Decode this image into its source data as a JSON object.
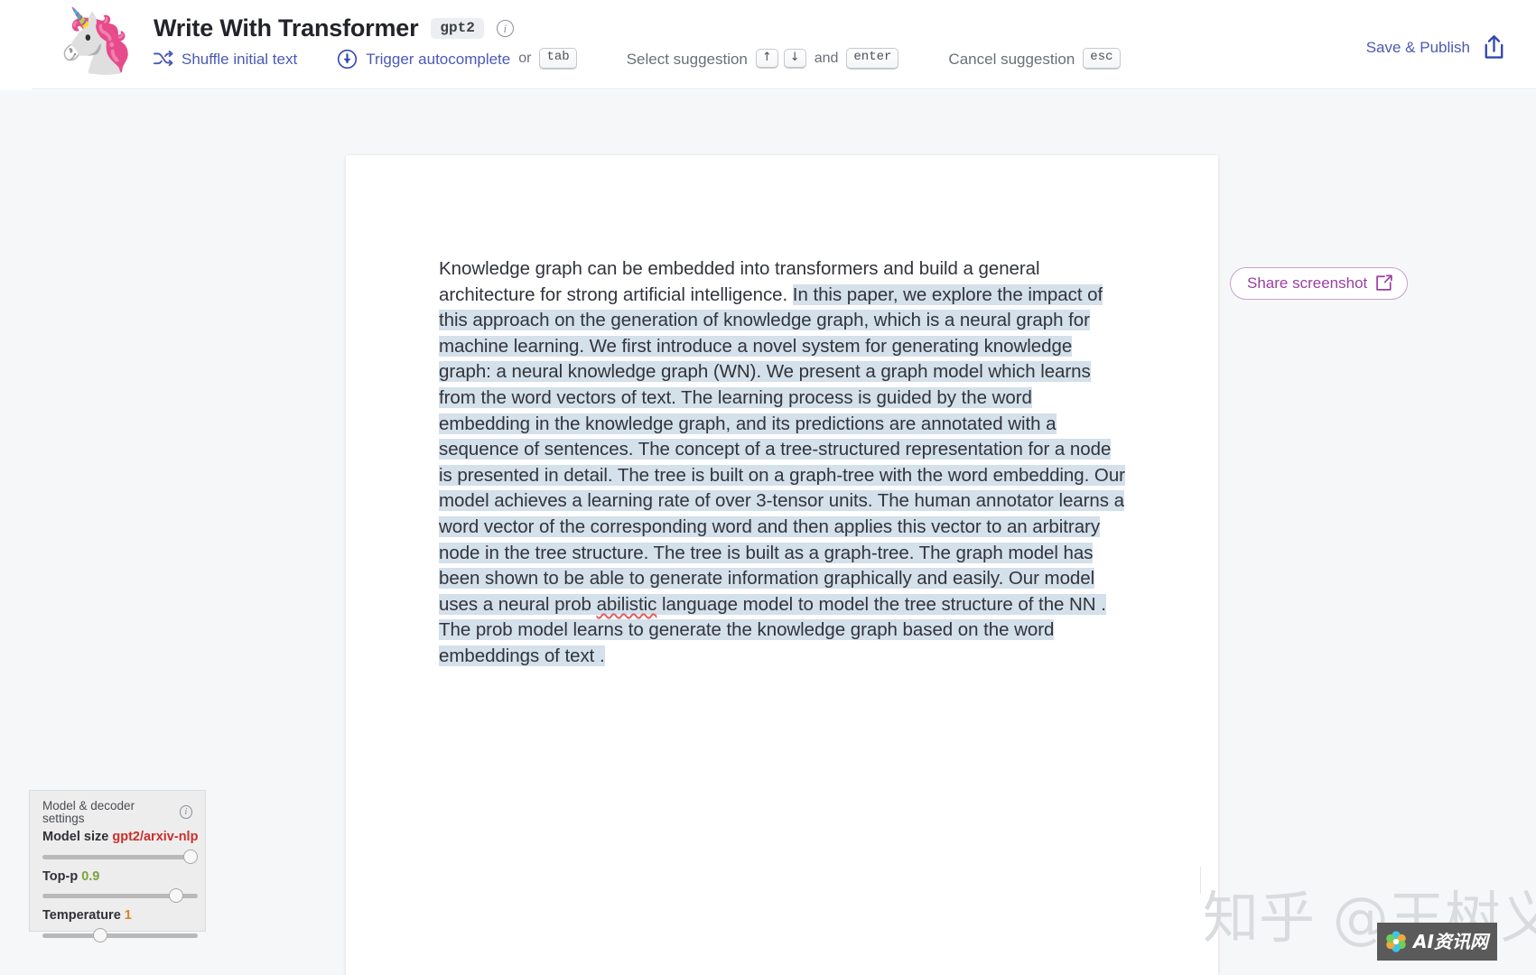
{
  "header": {
    "logo_icon": "unicorn-emoji",
    "title": "Write With Transformer",
    "model_badge": "gpt2",
    "info_icon": "info-icon",
    "actions": [
      {
        "icon": "shuffle-icon",
        "label": "Shuffle initial text"
      },
      {
        "icon": "download-circle-icon",
        "label": "Trigger autocomplete",
        "conn": "or",
        "keys": [
          "tab"
        ]
      },
      {
        "label": "Select suggestion",
        "keys": [
          "↑",
          "↓"
        ],
        "conn": "and",
        "keys2": [
          "enter"
        ]
      },
      {
        "label": "Cancel suggestion",
        "keys": [
          "esc"
        ]
      }
    ],
    "conn_or": "or",
    "conn_and": "and",
    "key_tab": "tab",
    "key_up": "↑",
    "key_down": "↓",
    "key_enter": "enter",
    "key_esc": "esc",
    "label_shuffle": "Shuffle initial text",
    "label_trigger": "Trigger autocomplete",
    "label_select": "Select suggestion",
    "label_cancel": "Cancel suggestion",
    "save_publish_label": "Save & Publish",
    "save_publish_icon": "share-up-icon"
  },
  "document": {
    "prompt_text": "Knowledge graph can be embedded into transformers and build a general architecture for strong artificial intelligence. ",
    "generated_part1": "In this paper, we explore the impact of this approach on the generation of knowledge graph, which is a neural graph for machine learning. We first introduce a novel system for generating knowledge graph: a neural knowledge graph (WN).  We present a graph model which learns from the word vectors of text. The learning process is guided by the word embedding in the knowledge graph, and its predictions are annotated with  a sequence of sentences. The concept of a tree-structured representation for a node is presented in detail. The tree is built on a graph-tree with the word embedding. Our model achieves a learning rate of over 3-tensor units. The human annotator learns a word vector of the corresponding  word and then applies this vector to an arbitrary node in the tree structure. The tree is built as a graph-tree. The graph model has been shown to be able to generate information graphically and easily. Our model uses a neural prob ",
    "misspelled_word": "abilistic",
    "generated_part2": " language model to model the tree structure of the NN . The prob model learns  to generate the knowledge graph based on the word embeddings of text ."
  },
  "share": {
    "label": "Share screenshot",
    "icon": "external-link-icon"
  },
  "settings": {
    "title": "Model & decoder settings",
    "info_icon": "info-icon",
    "controls": [
      {
        "label": "Model size",
        "value": "gpt2/arxiv-nlp",
        "value_color": "#c9302c",
        "knob_pct": 93
      },
      {
        "label": "Top-p",
        "value": "0.9",
        "value_color": "#7aa23d",
        "knob_pct": 84
      },
      {
        "label": "Temperature",
        "value": "1",
        "value_color": "#d98324",
        "knob_pct": 35
      }
    ]
  },
  "watermark": {
    "zhihu": "知乎 @王树义",
    "badge_text": "AI资讯网",
    "badge_icon": "flower-logo-icon"
  },
  "colors": {
    "page_bg": "#f6f7f9",
    "accent_link": "#4a5ab4",
    "highlight": "#d4e0ea",
    "share_accent": "#9a3fa0"
  }
}
